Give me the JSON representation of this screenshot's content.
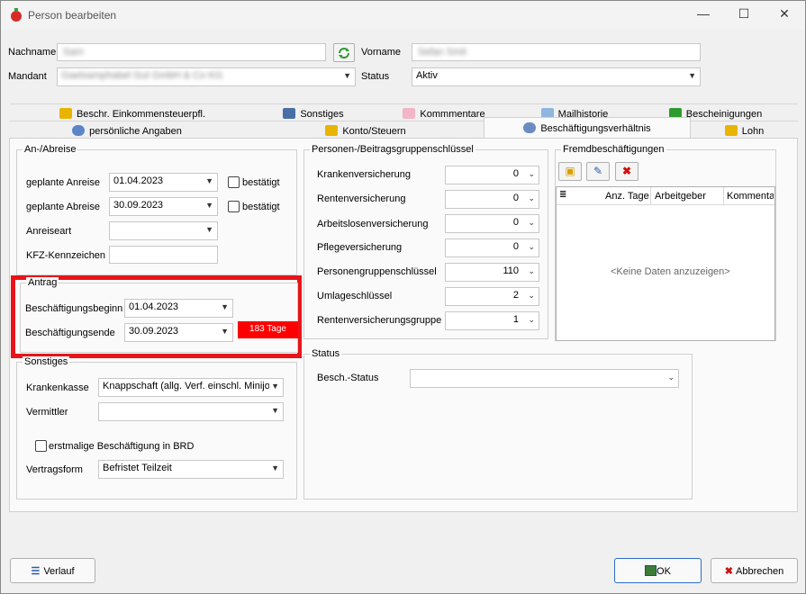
{
  "window": {
    "title": "Person bearbeiten",
    "minimize": "—",
    "maximize": "☐",
    "close": "✕"
  },
  "header": {
    "nachname_label": "Nachname",
    "nachname_value": "Sam",
    "vorname_label": "Vorname",
    "vorname_value": "Sefan Smit",
    "mandant_label": "Mandant",
    "mandant_value": "Gaelsamphabel Gut GmbH & Co KG",
    "status_label": "Status",
    "status_value": "Aktiv"
  },
  "tabs": {
    "row1": [
      "Beschr. Einkommensteuerpfl.",
      "Sonstiges",
      "Kommmentare",
      "Mailhistorie",
      "Bescheinigungen"
    ],
    "row2": [
      "persönliche Angaben",
      "Konto/Steuern",
      "Beschäftigungsverhältnis",
      "Lohn"
    ]
  },
  "anabreise": {
    "title": "An-/Abreise",
    "anreise_label": "geplante Anreise",
    "anreise_value": "01.04.2023",
    "abreise_label": "geplante Abreise",
    "abreise_value": "30.09.2023",
    "bestaetigt": "bestätigt",
    "anreiseart_label": "Anreiseart",
    "kfz_label": "KFZ-Kennzeichen"
  },
  "antrag": {
    "title": "Antrag",
    "beginn_label": "Beschäftigungsbeginn",
    "beginn_value": "01.04.2023",
    "ende_label": "Beschäftigungsende",
    "ende_value": "30.09.2023",
    "tage_badge": "183 Tage"
  },
  "sonstiges": {
    "title": "Sonstiges",
    "krankenkasse_label": "Krankenkasse",
    "krankenkasse_value": "Knappschaft (allg. Verf. einschl. Minijob",
    "vermittler_label": "Vermittler",
    "erstmalig_label": "erstmalige Beschäftigung in BRD",
    "vertragsform_label": "Vertragsform",
    "vertragsform_value": "Befristet Teilzeit"
  },
  "personen": {
    "title": "Personen-/Beitragsgruppenschlüssel",
    "rows": [
      {
        "label": "Krankenversicherung",
        "value": "0"
      },
      {
        "label": "Rentenversicherung",
        "value": "0"
      },
      {
        "label": "Arbeitslosenversicherung",
        "value": "0"
      },
      {
        "label": "Pflegeversicherung",
        "value": "0"
      },
      {
        "label": "Personengruppenschlüssel",
        "value": "110"
      },
      {
        "label": "Umlageschlüssel",
        "value": "2"
      },
      {
        "label": "Rentenversicherungsgruppe",
        "value": "1"
      }
    ]
  },
  "fremd": {
    "title": "Fremdbeschäftigungen",
    "columns": [
      "Anz. Tage",
      "Arbeitgeber",
      "Kommentar"
    ],
    "empty": "<Keine Daten anzuzeigen>"
  },
  "status_group": {
    "title": "Status",
    "besch_label": "Besch.-Status"
  },
  "footer": {
    "verlauf": "Verlauf",
    "ok": "OK",
    "abbrechen": "Abbrechen"
  },
  "colors": {
    "highlight_red": "#e8141a",
    "badge_red": "#ff0000"
  }
}
